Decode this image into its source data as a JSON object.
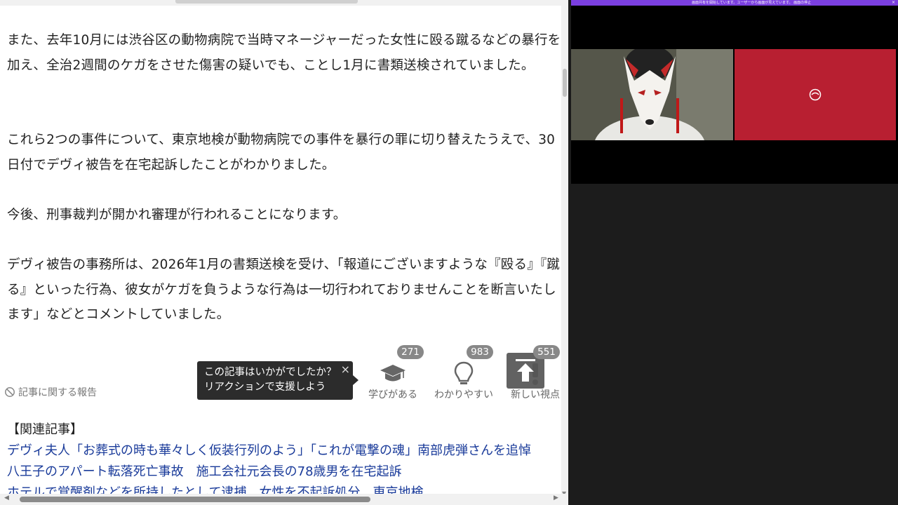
{
  "article": {
    "paragraphs": [
      "また、去年10月には渋谷区の動物病院で当時マネージャーだった女性に殴る蹴るなどの暴行を加え、全治2週間のケガをさせた傷害の疑いでも、ことし1月に書類送検されていました。",
      "これら2つの事件について、東京地検が動物病院での事件を暴行の罪に切り替えたうえで、30日付でデヴィ被告を在宅起訴したことがわかりました。",
      "今後、刑事裁判が開かれ審理が行われることになります。",
      "デヴィ被告の事務所は、2026年1月の書類送検を受け、「報道にございますような『殴る』『蹴る』といった行為、彼女がケガを負うような行為は一切行われておりませんことを断言いたします」などとコメントしていました。"
    ]
  },
  "report_link": {
    "label": "記事に関する報告",
    "icon": "prohibited-icon"
  },
  "tooltip": {
    "line1": "この記事はいかがでしたか？",
    "line2": "リアクションで支援しよう",
    "close": "×"
  },
  "reactions": [
    {
      "label": "学びがある",
      "count": "271",
      "icon": "graduation-cap-icon"
    },
    {
      "label": "わかりやすい",
      "count": "983",
      "icon": "lightbulb-icon"
    },
    {
      "label": "新しい視点",
      "count": "551",
      "icon": "exclamation-icon"
    }
  ],
  "scroll_top": {
    "icon": "arrow-up-to-top-icon"
  },
  "related": {
    "heading": "【関連記事】",
    "links": [
      "デヴィ夫人「お葬式の時も華々しく仮装行列のよう」「これが電撃の魂」南部虎弾さんを追悼",
      "八王子のアパート転落死亡事故　施工会社元会長の78歳男を在宅起訴",
      "ホテルで覚醒剤などを所持したとして逮捕　女性を不起訴処分　東京地検"
    ]
  },
  "right_pane": {
    "top_bar_text": "画面共有を開始しています。ユーザーから画面が見えています。 画面の停止",
    "close_mark": "×",
    "colors": {
      "top_bar": "#7b3fe0",
      "tile": "#b81f31"
    }
  }
}
